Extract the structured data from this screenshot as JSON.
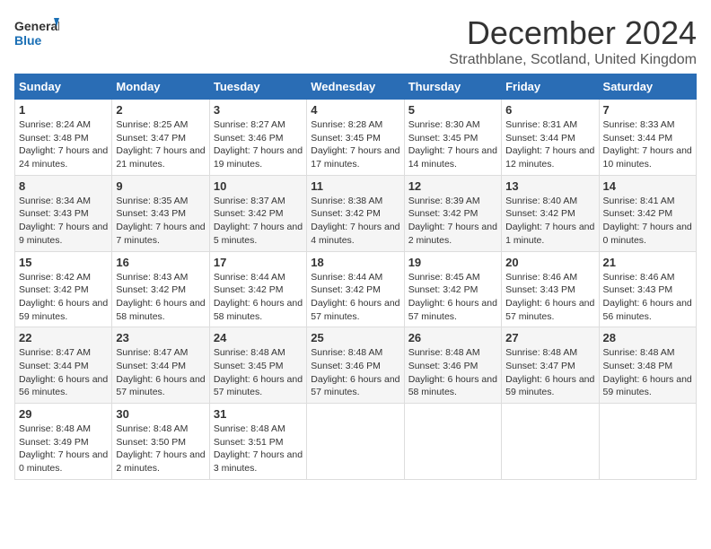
{
  "logo": {
    "line1": "General",
    "line2": "Blue"
  },
  "title": "December 2024",
  "subtitle": "Strathblane, Scotland, United Kingdom",
  "days": [
    "Sunday",
    "Monday",
    "Tuesday",
    "Wednesday",
    "Thursday",
    "Friday",
    "Saturday"
  ],
  "weeks": [
    [
      {
        "day": 1,
        "sunrise": "8:24 AM",
        "sunset": "3:48 PM",
        "daylight": "7 hours and 24 minutes."
      },
      {
        "day": 2,
        "sunrise": "8:25 AM",
        "sunset": "3:47 PM",
        "daylight": "7 hours and 21 minutes."
      },
      {
        "day": 3,
        "sunrise": "8:27 AM",
        "sunset": "3:46 PM",
        "daylight": "7 hours and 19 minutes."
      },
      {
        "day": 4,
        "sunrise": "8:28 AM",
        "sunset": "3:45 PM",
        "daylight": "7 hours and 17 minutes."
      },
      {
        "day": 5,
        "sunrise": "8:30 AM",
        "sunset": "3:45 PM",
        "daylight": "7 hours and 14 minutes."
      },
      {
        "day": 6,
        "sunrise": "8:31 AM",
        "sunset": "3:44 PM",
        "daylight": "7 hours and 12 minutes."
      },
      {
        "day": 7,
        "sunrise": "8:33 AM",
        "sunset": "3:44 PM",
        "daylight": "7 hours and 10 minutes."
      }
    ],
    [
      {
        "day": 8,
        "sunrise": "8:34 AM",
        "sunset": "3:43 PM",
        "daylight": "7 hours and 9 minutes."
      },
      {
        "day": 9,
        "sunrise": "8:35 AM",
        "sunset": "3:43 PM",
        "daylight": "7 hours and 7 minutes."
      },
      {
        "day": 10,
        "sunrise": "8:37 AM",
        "sunset": "3:42 PM",
        "daylight": "7 hours and 5 minutes."
      },
      {
        "day": 11,
        "sunrise": "8:38 AM",
        "sunset": "3:42 PM",
        "daylight": "7 hours and 4 minutes."
      },
      {
        "day": 12,
        "sunrise": "8:39 AM",
        "sunset": "3:42 PM",
        "daylight": "7 hours and 2 minutes."
      },
      {
        "day": 13,
        "sunrise": "8:40 AM",
        "sunset": "3:42 PM",
        "daylight": "7 hours and 1 minute."
      },
      {
        "day": 14,
        "sunrise": "8:41 AM",
        "sunset": "3:42 PM",
        "daylight": "7 hours and 0 minutes."
      }
    ],
    [
      {
        "day": 15,
        "sunrise": "8:42 AM",
        "sunset": "3:42 PM",
        "daylight": "6 hours and 59 minutes."
      },
      {
        "day": 16,
        "sunrise": "8:43 AM",
        "sunset": "3:42 PM",
        "daylight": "6 hours and 58 minutes."
      },
      {
        "day": 17,
        "sunrise": "8:44 AM",
        "sunset": "3:42 PM",
        "daylight": "6 hours and 58 minutes."
      },
      {
        "day": 18,
        "sunrise": "8:44 AM",
        "sunset": "3:42 PM",
        "daylight": "6 hours and 57 minutes."
      },
      {
        "day": 19,
        "sunrise": "8:45 AM",
        "sunset": "3:42 PM",
        "daylight": "6 hours and 57 minutes."
      },
      {
        "day": 20,
        "sunrise": "8:46 AM",
        "sunset": "3:43 PM",
        "daylight": "6 hours and 57 minutes."
      },
      {
        "day": 21,
        "sunrise": "8:46 AM",
        "sunset": "3:43 PM",
        "daylight": "6 hours and 56 minutes."
      }
    ],
    [
      {
        "day": 22,
        "sunrise": "8:47 AM",
        "sunset": "3:44 PM",
        "daylight": "6 hours and 56 minutes."
      },
      {
        "day": 23,
        "sunrise": "8:47 AM",
        "sunset": "3:44 PM",
        "daylight": "6 hours and 57 minutes."
      },
      {
        "day": 24,
        "sunrise": "8:48 AM",
        "sunset": "3:45 PM",
        "daylight": "6 hours and 57 minutes."
      },
      {
        "day": 25,
        "sunrise": "8:48 AM",
        "sunset": "3:46 PM",
        "daylight": "6 hours and 57 minutes."
      },
      {
        "day": 26,
        "sunrise": "8:48 AM",
        "sunset": "3:46 PM",
        "daylight": "6 hours and 58 minutes."
      },
      {
        "day": 27,
        "sunrise": "8:48 AM",
        "sunset": "3:47 PM",
        "daylight": "6 hours and 59 minutes."
      },
      {
        "day": 28,
        "sunrise": "8:48 AM",
        "sunset": "3:48 PM",
        "daylight": "6 hours and 59 minutes."
      }
    ],
    [
      {
        "day": 29,
        "sunrise": "8:48 AM",
        "sunset": "3:49 PM",
        "daylight": "7 hours and 0 minutes."
      },
      {
        "day": 30,
        "sunrise": "8:48 AM",
        "sunset": "3:50 PM",
        "daylight": "7 hours and 2 minutes."
      },
      {
        "day": 31,
        "sunrise": "8:48 AM",
        "sunset": "3:51 PM",
        "daylight": "7 hours and 3 minutes."
      },
      null,
      null,
      null,
      null
    ]
  ]
}
